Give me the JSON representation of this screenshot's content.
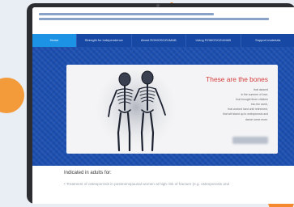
{
  "nav": {
    "items": [
      {
        "label": "Home"
      },
      {
        "label": "Strength for independence"
      },
      {
        "label": "About ROMOSOZUMAB"
      },
      {
        "label": "Using ROMOSOZUMAB"
      },
      {
        "label": "Support materials"
      }
    ]
  },
  "hero": {
    "title": "These are the bones",
    "lines": [
      "that danced",
      "in the summer of love,",
      "that brought three children",
      "into the world,",
      "that worked hard until retirement,",
      "that will stand up to osteoporosis and",
      "dance some more."
    ]
  },
  "content": {
    "heading": "Indicated in adults for:",
    "line": "• Treatment of osteoporosis in postmenopausal women at high risk of fracture (e.g. osteoporosis and"
  },
  "colors": {
    "nav_bg": "#1749a4",
    "nav_active": "#1d93e6",
    "hero_title": "#d43b3b",
    "accent_orange": "#f39a3a"
  }
}
